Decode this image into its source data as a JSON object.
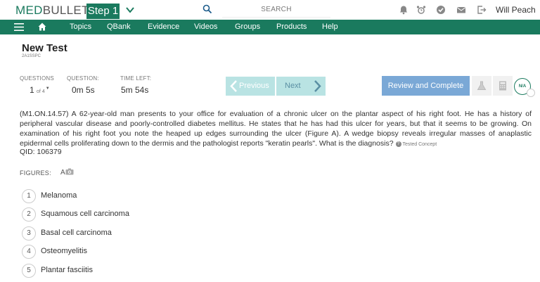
{
  "brand": {
    "logo_med": "MED",
    "logo_bullets": "BULLETS",
    "step": "Step 1"
  },
  "search": {
    "placeholder": "SEARCH"
  },
  "user": {
    "name": "Will Peach"
  },
  "nav": [
    "Topics",
    "QBank",
    "Evidence",
    "Videos",
    "Groups",
    "Products",
    "Help"
  ],
  "test": {
    "title": "New Test",
    "code": "2A1SSPC"
  },
  "stats": {
    "questions_label": "QUESTIONS",
    "questions_current": "1",
    "questions_of": "of 4",
    "question_time_label": "QUESTION:",
    "question_time": "0m 5s",
    "time_left_label": "TIME LEFT:",
    "time_left": "5m 54s"
  },
  "buttons": {
    "previous": "Previous",
    "next": "Next",
    "review": "Review and Complete",
    "na": "N/A"
  },
  "question": {
    "text": "(M1.ON.14.57) A 62-year-old man presents to your office for evaluation of a chronic ulcer on the plantar aspect of his right foot. He has a history of peripheral vascular disease and poorly-controlled diabetes mellitus. He states that he has had this ulcer for years, but that it seems to be growing. On examination of his right foot you note the heaped up edges surrounding the ulcer (Figure A). A wedge biopsy reveals irregular masses of anaplastic epidermal cells proliferating down to the dermis and the pathologist reports \"keratin pearls\". What is the diagnosis?",
    "tested_concept": "Tested Concept",
    "qid": "QID: 106379"
  },
  "figures": {
    "label": "FIGURES:",
    "items": [
      "A"
    ]
  },
  "answers": [
    {
      "num": "1",
      "text": "Melanoma"
    },
    {
      "num": "2",
      "text": "Squamous cell carcinoma"
    },
    {
      "num": "3",
      "text": "Basal cell carcinoma"
    },
    {
      "num": "4",
      "text": "Osteomyelitis"
    },
    {
      "num": "5",
      "text": "Plantar fasciitis"
    }
  ],
  "colors": {
    "brand_green": "#1a7a5e",
    "nav_disabled": "#b9e3e3",
    "review_blue": "#7aa8d6"
  },
  "icons": [
    "chevron-down-icon",
    "search-icon",
    "bell-icon",
    "alarm-icon",
    "check-circle-icon",
    "mail-icon",
    "logout-icon",
    "hamburger-icon",
    "home-icon",
    "flask-icon",
    "calculator-icon",
    "camera-icon"
  ]
}
